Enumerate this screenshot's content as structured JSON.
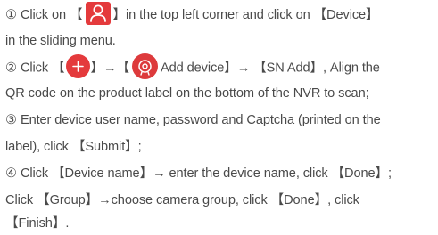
{
  "colors": {
    "text": "#4a4a4a",
    "icon_red": "#e43a3c"
  },
  "icons": {
    "user": "user-outline-icon",
    "plus": "plus-circle-icon",
    "add_device": "add-device-icon"
  },
  "step1": {
    "l1a": "① Click on 【",
    "l1b": "】in the top left corner and click on 【Device】",
    "l2": "in the sliding menu."
  },
  "step2": {
    "l3a": "② Click 【",
    "l3b": "】→【",
    "l3c": "Add device】→ 【SN Add】, Align the",
    "l4": "QR code on the product label on the bottom of the NVR to scan;"
  },
  "step3": {
    "l5": "③ Enter device user name, password and Captcha (printed on the",
    "l6": "label), click 【Submit】;"
  },
  "step4": {
    "l7": "④ Click 【Device name】→ enter the device name, click 【Done】;",
    "l8": "Click 【Group】→choose camera group, click 【Done】, click",
    "l9": "【Finish】."
  }
}
